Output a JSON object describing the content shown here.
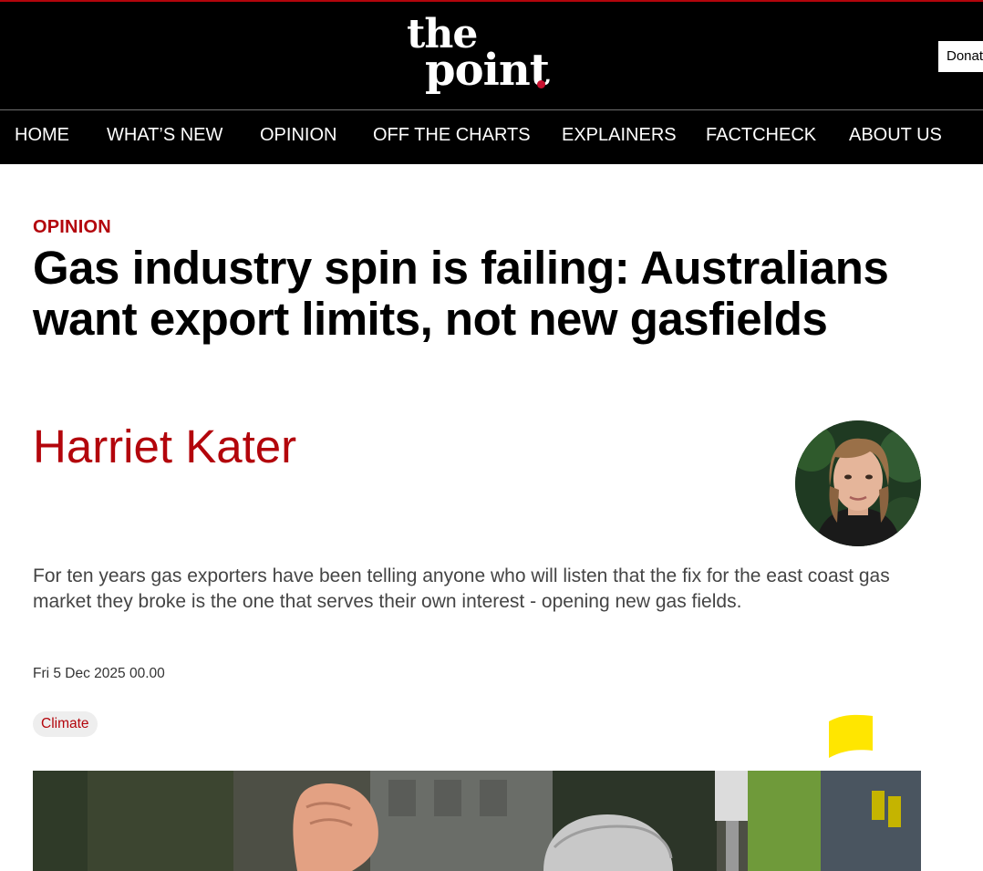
{
  "site": {
    "logo_line1": "the",
    "logo_line2": "point",
    "brand_accent": "#c8102e",
    "donate_label": "Donate"
  },
  "nav": {
    "items": [
      "HOME",
      "WHAT’S NEW",
      "OPINION",
      "OFF THE CHARTS",
      "EXPLAINERS",
      "FACTCHECK",
      "ABOUT US"
    ]
  },
  "article": {
    "category": "OPINION",
    "headline": "Gas industry spin is failing: Australians want export limits, not new gasfields",
    "author": "Harriet Kater",
    "standfirst": "For ten years gas exporters have been telling anyone who will listen that the fix for the east coast gas market they broke is the one that serves their own interest - opening new gas fields.",
    "date": "Fri 5 Dec 2025 00.00",
    "tag": "Climate"
  },
  "colors": {
    "accent_red": "#b3050c",
    "header_bg": "#000000",
    "flag_yellow": "#ffe600"
  },
  "icons": {
    "flag": "yellow-flag-icon"
  }
}
